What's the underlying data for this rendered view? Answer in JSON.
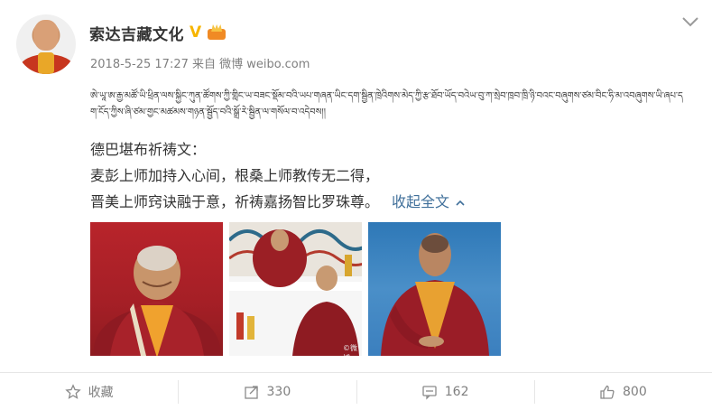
{
  "post": {
    "username": "索达吉藏文化",
    "verified_badge": "V",
    "timestamp": "2018-5-25 17:27",
    "source": "来自 微博 weibo.com",
    "tibetan_text": "ཨེ་ཡཱ་ཨ་རྒྱ་མཚོ་ཡི་ཕྲིན་ལས་སྐྱིང་ཀུན་ཚོགས་ཀྱི་གླིང་ཡ་བཟང་སྡོམ་བའི་ཡཔ་གཞན་ཡིང་དག་སྦྱིན་ཁྲེའིགས་མེད་ཀྱི་རྩ་ཐོབ་ཡོད་བའེཡ་བུ་ཀ་སྲེབ་ཁྲབ་ཁྲི་ཉི་བའང་བཞུགས་ཙམ་བིང་ཧི་མ་འབཞུགས་ཡི་ཞཔ་དག་ངོད་ཀྱིས་ཞི་ཙམ་གྱང་མཚམས་གཉན་སྦྱོད་བའི་སྒྲོ་རེ་སྦྱིན་ལ་གསོལ་བ་འདེབས།།",
    "lines": [
      "德巴堪布祈祷文：",
      "麦彭上师加持入心间，根桑上师教传无二得，",
      "晋美上师窍诀融于意，祈祷嘉扬智比罗珠尊。"
    ],
    "collapse_label": "收起全文",
    "watermark": "©微博"
  },
  "actions": {
    "favorite_label": "收藏",
    "repost_count": "330",
    "comment_count": "162",
    "like_count": "800"
  },
  "icons": {
    "verified": "verified-v-icon",
    "member": "member-crown-icon",
    "menu": "chevron-down-icon",
    "collapse": "chevron-up-icon",
    "favorite": "star-icon",
    "repost": "share-arrow-icon",
    "comment": "comment-bubble-icon",
    "like": "thumbs-up-icon"
  },
  "colors": {
    "link": "#3f6f9a",
    "verified": "#f7b500",
    "muted": "#808080"
  }
}
